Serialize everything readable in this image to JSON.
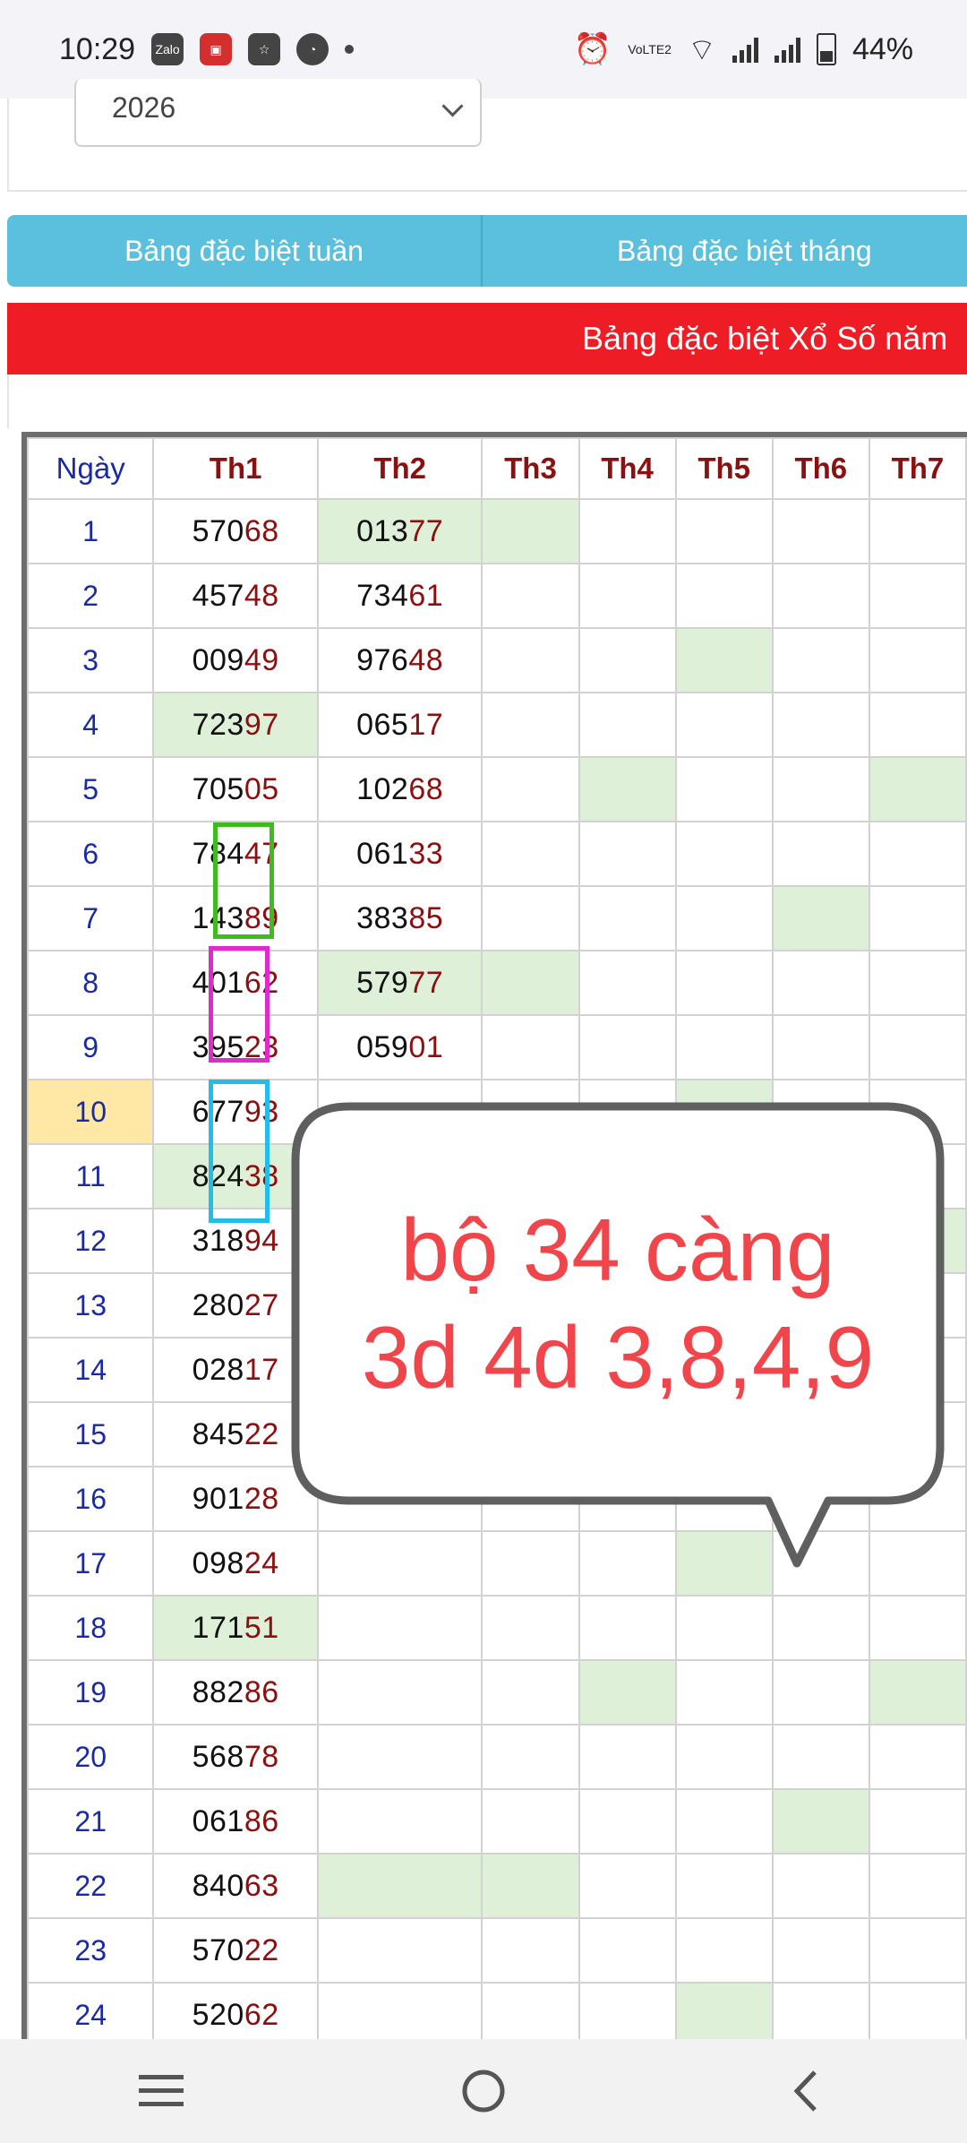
{
  "status_bar": {
    "time": "10:29",
    "left_icons": [
      "zalo-icon",
      "shield-app-icon",
      "star-badge-icon",
      "gauge-icon"
    ],
    "zalo_label": "Zalo",
    "lte_label": "VoLTE2",
    "battery": "44%",
    "right_icons": [
      "alarm-icon",
      "lte-icon",
      "wifi-icon",
      "signal-icon",
      "signal-icon",
      "battery-icon"
    ]
  },
  "year_select": {
    "value": "2026"
  },
  "tabs": [
    {
      "label": "Bảng đặc biệt tuần"
    },
    {
      "label": "Bảng đặc biệt tháng"
    }
  ],
  "banner": {
    "title": "Bảng đặc biệt Xổ Số năm"
  },
  "table": {
    "headers": [
      "Ngày",
      "Th1",
      "Th2",
      "Th3",
      "Th4",
      "Th5",
      "Th6",
      "Th7"
    ],
    "highlight_color": "#dff0d8",
    "today_day": "10",
    "rows": [
      {
        "day": "1",
        "th1": "57068",
        "th2": "01377"
      },
      {
        "day": "2",
        "th1": "45748",
        "th2": "73461"
      },
      {
        "day": "3",
        "th1": "00949",
        "th2": "97648"
      },
      {
        "day": "4",
        "th1": "72397",
        "th2": "06517"
      },
      {
        "day": "5",
        "th1": "70505",
        "th2": "10268"
      },
      {
        "day": "6",
        "th1": "78447",
        "th2": "06133"
      },
      {
        "day": "7",
        "th1": "14389",
        "th2": "38385"
      },
      {
        "day": "8",
        "th1": "40162",
        "th2": "57977"
      },
      {
        "day": "9",
        "th1": "39523",
        "th2": "05901"
      },
      {
        "day": "10",
        "th1": "67793",
        "th2": ""
      },
      {
        "day": "11",
        "th1": "82438",
        "th2": ""
      },
      {
        "day": "12",
        "th1": "31894",
        "th2": ""
      },
      {
        "day": "13",
        "th1": "28027",
        "th2": ""
      },
      {
        "day": "14",
        "th1": "02817",
        "th2": ""
      },
      {
        "day": "15",
        "th1": "84522",
        "th2": ""
      },
      {
        "day": "16",
        "th1": "90128",
        "th2": ""
      },
      {
        "day": "17",
        "th1": "09824",
        "th2": ""
      },
      {
        "day": "18",
        "th1": "17151",
        "th2": ""
      },
      {
        "day": "19",
        "th1": "88286",
        "th2": ""
      },
      {
        "day": "20",
        "th1": "56878",
        "th2": ""
      },
      {
        "day": "21",
        "th1": "06186",
        "th2": ""
      },
      {
        "day": "22",
        "th1": "84063",
        "th2": ""
      },
      {
        "day": "23",
        "th1": "57022",
        "th2": ""
      },
      {
        "day": "24",
        "th1": "52062",
        "th2": ""
      }
    ]
  },
  "annotation": {
    "line1": "bộ 34 càng",
    "line2": "3d 4d 3,8,4,9",
    "text_color": "#f0454a",
    "marker_colors": [
      "#3dbb1f",
      "#de2bc9",
      "#22bde9"
    ]
  },
  "nav_bar": {
    "icons": [
      "menu-icon",
      "home-icon",
      "back-icon"
    ]
  }
}
